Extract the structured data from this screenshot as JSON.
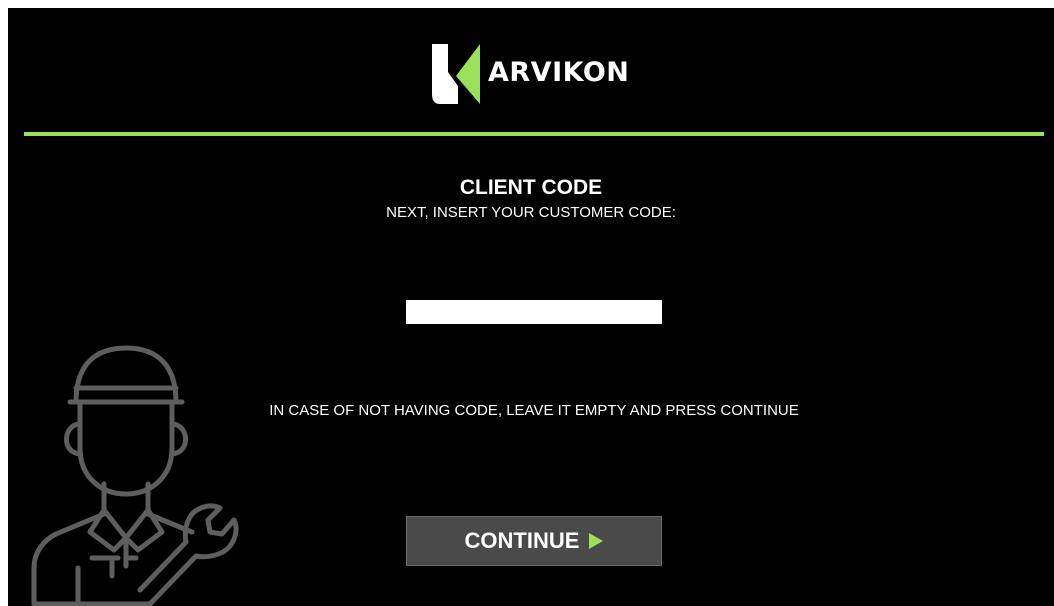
{
  "brand": {
    "name": "ARVIKON",
    "logo_icon": "arvikon-leaf-logo",
    "accent_color": "#9be05a",
    "background_color": "#000000"
  },
  "form": {
    "title": "CLIENT CODE",
    "subtitle": "NEXT, INSERT YOUR CUSTOMER CODE:",
    "code_value": "",
    "notice": "IN CASE OF NOT HAVING CODE, LEAVE IT EMPTY AND PRESS CONTINUE",
    "continue_label": "CONTINUE",
    "continue_icon": "play-arrow-icon"
  },
  "illustration": {
    "icon": "mechanic-with-wrench-icon"
  }
}
